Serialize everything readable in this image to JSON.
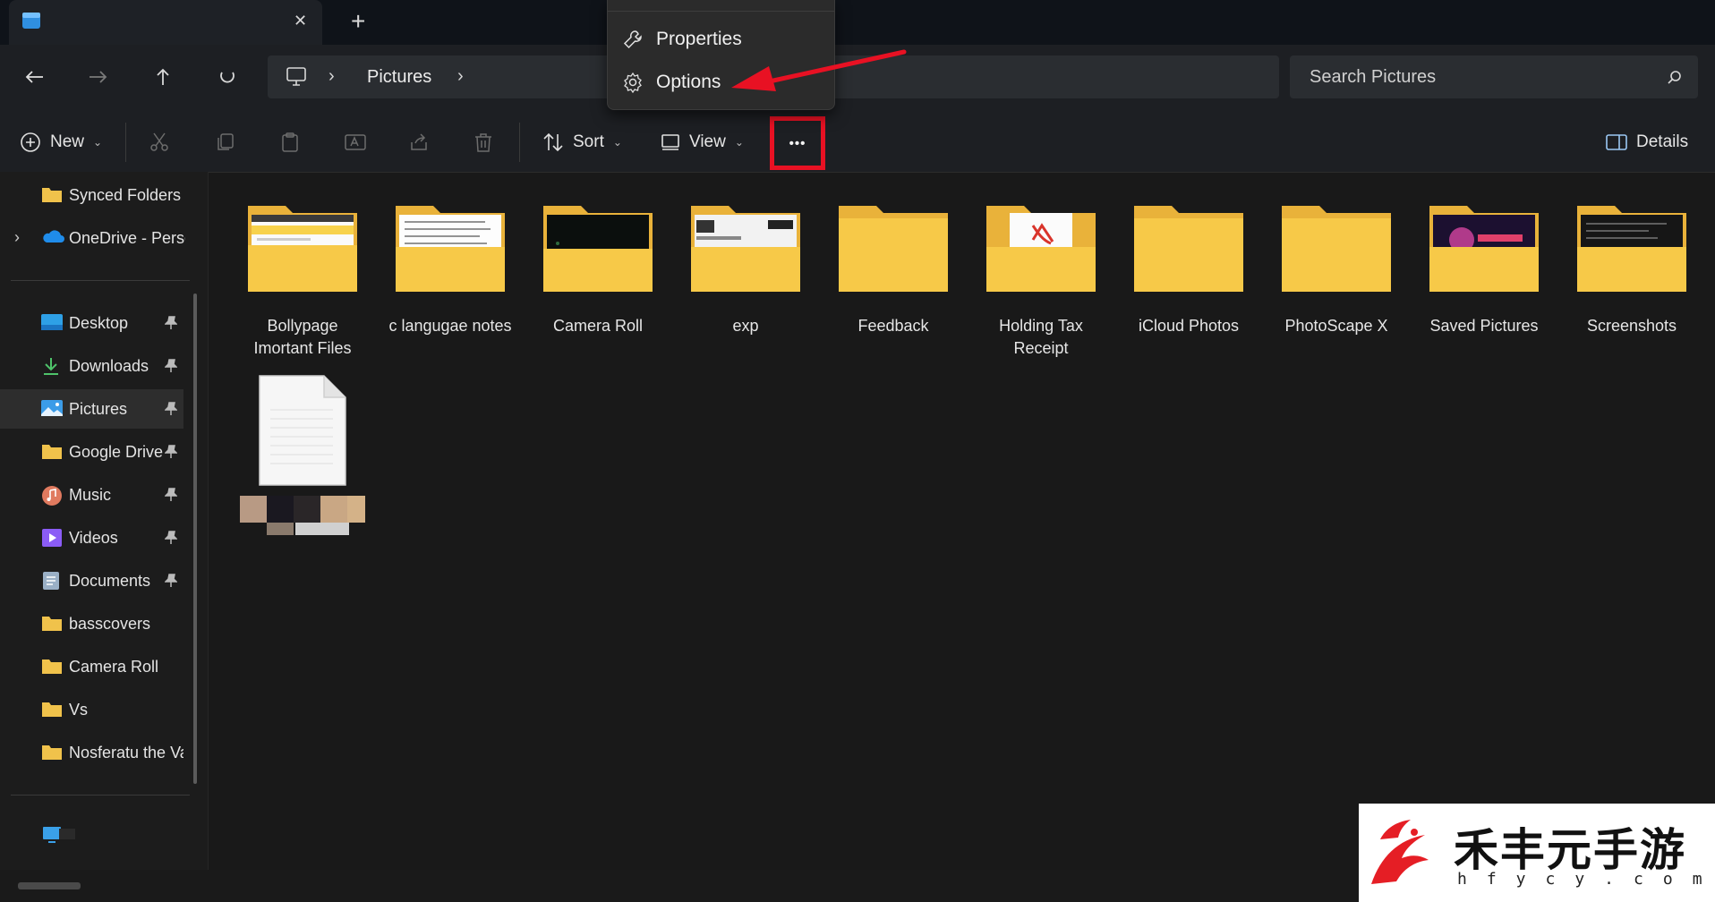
{
  "tab": {
    "title": "",
    "close_glyph": "✕",
    "new_tab_glyph": "+"
  },
  "breadcrumb": {
    "segments": [
      "Pictures"
    ]
  },
  "search": {
    "placeholder": "Search Pictures"
  },
  "toolbar": {
    "new_label": "New",
    "sort_label": "Sort",
    "view_label": "View",
    "more_glyph": "•••",
    "details_label": "Details"
  },
  "menu": {
    "items": [
      "Properties",
      "Options"
    ]
  },
  "sidebar": {
    "top_items": [
      "Synced Folders",
      "OneDrive - Perso"
    ],
    "pinned_items": [
      "Desktop",
      "Downloads",
      "Pictures",
      "Google Drive",
      "Music",
      "Videos",
      "Documents"
    ],
    "folders": [
      "basscovers",
      "Camera Roll",
      "Vs",
      "Nosferatu the Va"
    ],
    "selected": "Pictures"
  },
  "files": [
    {
      "name": "Bollypage Imortant Files",
      "preview": "doc-yellow"
    },
    {
      "name": "c langugae notes",
      "preview": "handwriting"
    },
    {
      "name": "Camera Roll",
      "preview": "dark"
    },
    {
      "name": "exp",
      "preview": "screenshots"
    },
    {
      "name": "Feedback",
      "preview": "empty"
    },
    {
      "name": "Holding Tax Receipt",
      "preview": "pdf"
    },
    {
      "name": "iCloud Photos",
      "preview": "empty"
    },
    {
      "name": "PhotoScape X",
      "preview": "empty"
    },
    {
      "name": "Saved Pictures",
      "preview": "colorful"
    },
    {
      "name": "Screenshots",
      "preview": "dark-text"
    }
  ],
  "watermark": {
    "title": "禾丰元手游",
    "url": "hfycy.com"
  },
  "colors": {
    "accent": "#0078d4",
    "highlight": "#e81123",
    "folder": "#f7c948",
    "folder_dark": "#e9b23a"
  }
}
